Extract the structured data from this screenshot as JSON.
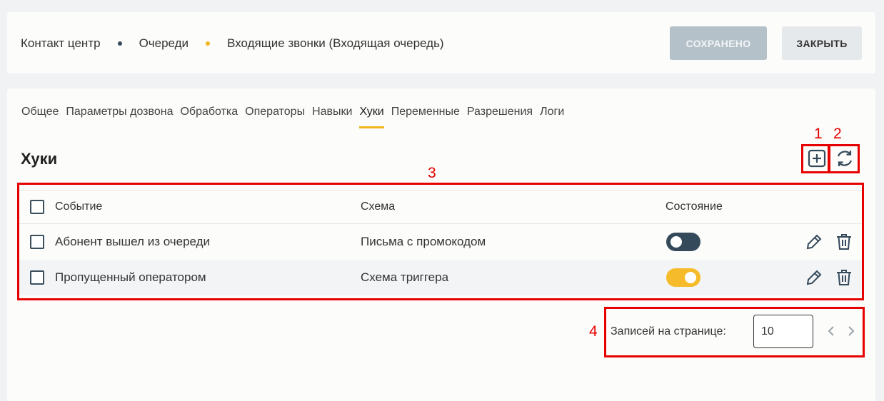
{
  "breadcrumb": {
    "items": [
      "Контакт центр",
      "Очереди",
      "Входящие звонки (Входящая очередь)"
    ],
    "dot_colors": [
      "#34495a",
      "#f2b41f"
    ]
  },
  "header_buttons": {
    "saved_label": "СОХРАНЕНО",
    "close_label": "ЗАКРЫТЬ"
  },
  "tabs": [
    {
      "label": "Общее"
    },
    {
      "label": "Параметры дозвона"
    },
    {
      "label": "Обработка"
    },
    {
      "label": "Операторы"
    },
    {
      "label": "Навыки"
    },
    {
      "label": "Хуки",
      "active": true
    },
    {
      "label": "Переменные"
    },
    {
      "label": "Разрешения"
    },
    {
      "label": "Логи"
    }
  ],
  "section": {
    "title": "Хуки"
  },
  "toolbar": {
    "add_icon": "plus-square-icon",
    "refresh_icon": "refresh-icon"
  },
  "annotations": [
    "1",
    "2",
    "3",
    "4"
  ],
  "table": {
    "columns": [
      "Событие",
      "Схема",
      "Состояние"
    ],
    "rows": [
      {
        "event": "Абонент вышел из очереди",
        "schema": "Письма с промокодом",
        "enabled": false
      },
      {
        "event": "Пропущенный оператором",
        "schema": "Схема триггера",
        "enabled": true
      }
    ]
  },
  "pagination": {
    "label": "Записей на странице:",
    "page_size": "10"
  },
  "colors": {
    "accent": "#f2b41f",
    "dark": "#34495a",
    "annotation": "#e60000"
  }
}
